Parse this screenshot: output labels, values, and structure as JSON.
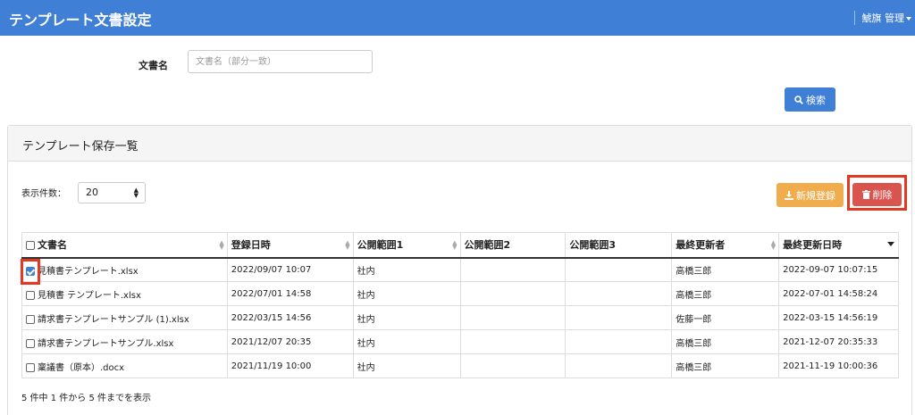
{
  "header": {
    "title": "テンプレート文書設定",
    "user": "鯱旗 管理"
  },
  "search": {
    "label": "文書名",
    "placeholder": "文書名（部分一致）",
    "button": "検索"
  },
  "panel": {
    "title": "テンプレート保存一覧"
  },
  "controls": {
    "count_label": "表示件数：",
    "count_value": "20",
    "new_button": "新規登録",
    "delete_button": "削除"
  },
  "table": {
    "headers": [
      "文書名",
      "登録日時",
      "公開範囲1",
      "公開範囲2",
      "公開範囲3",
      "最終更新者",
      "最終更新日時"
    ],
    "rows": [
      {
        "checked": true,
        "name": "見積書テンプレート.xlsx",
        "registered": "2022/09/07 10:07",
        "scope1": "社内",
        "scope2": "",
        "scope3": "",
        "updater": "高橋三郎",
        "updated": "2022-09-07 10:07:15"
      },
      {
        "checked": false,
        "name": "見積書 テンプレート.xlsx",
        "registered": "2022/07/01 14:58",
        "scope1": "社内",
        "scope2": "",
        "scope3": "",
        "updater": "高橋三郎",
        "updated": "2022-07-01 14:58:24"
      },
      {
        "checked": false,
        "name": "請求書テンプレートサンプル (1).xlsx",
        "registered": "2022/03/15 14:56",
        "scope1": "社内",
        "scope2": "",
        "scope3": "",
        "updater": "佐藤一郎",
        "updated": "2022-03-15 14:56:19"
      },
      {
        "checked": false,
        "name": "請求書テンプレートサンプル.xlsx",
        "registered": "2021/12/07 20:35",
        "scope1": "社内",
        "scope2": "",
        "scope3": "",
        "updater": "高橋三郎",
        "updated": "2021-12-07 20:35:33"
      },
      {
        "checked": false,
        "name": "稟議書（原本）.docx",
        "registered": "2021/11/19 10:00",
        "scope1": "社内",
        "scope2": "",
        "scope3": "",
        "updater": "高橋三郎",
        "updated": "2021-11-19 10:00:36"
      }
    ]
  },
  "footer": {
    "info": "5 件中 1 件から 5 件までを表示"
  },
  "colors": {
    "primary": "#3f7fd6",
    "warning": "#f0ad4e",
    "danger": "#d9534f",
    "highlight": "#e23a22"
  }
}
